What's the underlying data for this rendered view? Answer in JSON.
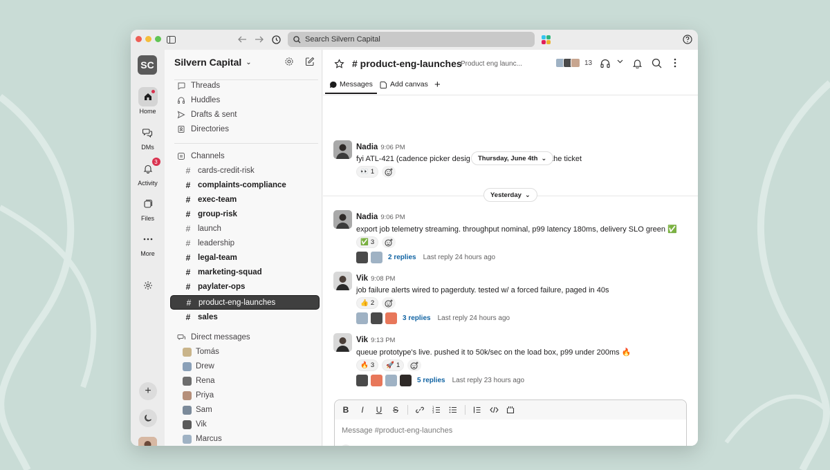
{
  "browser": {
    "search_placeholder": "Search Silvern Capital"
  },
  "rail": {
    "workspace_initials": "SC",
    "items": [
      {
        "label": "Home"
      },
      {
        "label": "DMs"
      },
      {
        "label": "Activity",
        "badge": "3"
      },
      {
        "label": "Files"
      },
      {
        "label": "More"
      }
    ]
  },
  "sidebar": {
    "workspace_name": "Silvern Capital",
    "top_items": [
      {
        "label": "Threads"
      },
      {
        "label": "Huddles"
      },
      {
        "label": "Drafts & sent"
      },
      {
        "label": "Directories"
      }
    ],
    "channels_header": "Channels",
    "channels": [
      {
        "name": "cards-credit-risk",
        "unread": false
      },
      {
        "name": "complaints-compliance",
        "unread": true
      },
      {
        "name": "exec-team",
        "unread": true
      },
      {
        "name": "group-risk",
        "unread": true
      },
      {
        "name": "launch",
        "unread": false
      },
      {
        "name": "leadership",
        "unread": false
      },
      {
        "name": "legal-team",
        "unread": true
      },
      {
        "name": "marketing-squad",
        "unread": true
      },
      {
        "name": "paylater-ops",
        "unread": true
      },
      {
        "name": "product-eng-launches",
        "selected": true
      },
      {
        "name": "sales",
        "unread": true
      }
    ],
    "dm_header": "Direct messages",
    "dms": [
      {
        "name": "Tomás",
        "color": "#c9b48a"
      },
      {
        "name": "Drew",
        "color": "#8aa0b8"
      },
      {
        "name": "Rena",
        "color": "#6d6d6d"
      },
      {
        "name": "Priya",
        "color": "#b58f7a"
      },
      {
        "name": "Sam",
        "color": "#7b8a9a"
      },
      {
        "name": "Vik",
        "color": "#5a5a5a"
      },
      {
        "name": "Marcus",
        "color": "#9fb2c4"
      }
    ]
  },
  "channel": {
    "name": "# product-eng-launches",
    "topic": "Product eng launc...",
    "member_count": "13",
    "tabs": [
      {
        "label": "Messages"
      },
      {
        "label": "Add canvas"
      }
    ]
  },
  "dates": {
    "floating": "Thursday, June 4th",
    "yesterday": "Yesterday"
  },
  "messages": [
    {
      "author": "Nadia",
      "time": "9:06 PM",
      "text_before": "fyi ATL-421 (cadence picker desig",
      "text_after": "s in the ticket",
      "reactions": [
        {
          "emoji": "👀",
          "count": "1"
        }
      ]
    },
    {
      "author": "Nadia",
      "time": "9:06 PM",
      "text": "export job telemetry streaming. throughput nominal, p99 latency 180ms, delivery SLO green ✅",
      "reactions": [
        {
          "emoji": "✅",
          "count": "3"
        }
      ],
      "replies": "2 replies",
      "last_reply": "Last reply 24 hours ago"
    },
    {
      "author": "Vik",
      "time": "9:08 PM",
      "text": "job failure alerts wired to pagerduty. tested w/ a forced failure, paged in 40s",
      "reactions": [
        {
          "emoji": "👍",
          "count": "2"
        }
      ],
      "replies": "3 replies",
      "last_reply": "Last reply 24 hours ago"
    },
    {
      "author": "Vik",
      "time": "9:13 PM",
      "text": "queue prototype's live. pushed it to 50k/sec on the load box, p99 under 200ms 🔥",
      "reactions": [
        {
          "emoji": "🔥",
          "count": "3"
        },
        {
          "emoji": "🚀",
          "count": "1"
        }
      ],
      "replies": "5 replies",
      "last_reply": "Last reply 23 hours ago"
    }
  ],
  "composer": {
    "placeholder": "Message #product-eng-launches"
  },
  "colors": {
    "accent_link": "#1264a3",
    "badge_red": "#d9324f",
    "selected_channel": "#3f3f3f"
  }
}
